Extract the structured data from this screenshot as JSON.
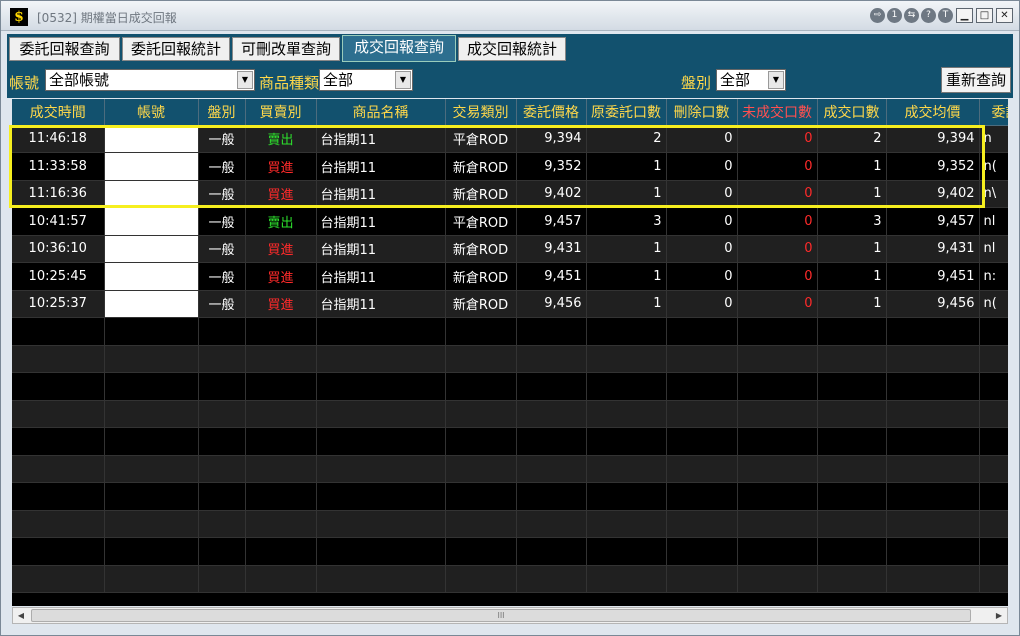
{
  "window": {
    "title": "[0532] 期權當日成交回報",
    "round_buttons": [
      "⇨",
      "1",
      "⇆",
      "?",
      "T"
    ],
    "min": "▁",
    "max": "□",
    "close": "✕"
  },
  "app_icon": "$",
  "tabs": [
    {
      "label": "委託回報查詢"
    },
    {
      "label": "委託回報統計"
    },
    {
      "label": "可刪改單查詢"
    },
    {
      "label": "成交回報查詢"
    },
    {
      "label": "成交回報統計"
    }
  ],
  "filters": {
    "account_label": "帳號",
    "account_value": "全部帳號",
    "product_label": "商品種類",
    "product_value": "全部",
    "session_label": "盤別",
    "session_value": "全部",
    "query_button": "重新查詢"
  },
  "columns": [
    "成交時間",
    "帳號",
    "盤別",
    "買賣別",
    "商品名稱",
    "交易類別",
    "委託價格",
    "原委託口數",
    "刪除口數",
    "未成交口數",
    "成交口數",
    "成交均價",
    "委託"
  ],
  "rows": [
    {
      "time": "11:46:18",
      "account": "",
      "session": "一般",
      "side": "賣出",
      "product": "台指期11",
      "type": "平倉ROD",
      "price": "9,394",
      "orig": "2",
      "del": "0",
      "unfilled": "0",
      "filled": "2",
      "avg": "9,394",
      "extra": "n"
    },
    {
      "time": "11:33:58",
      "account": "",
      "session": "一般",
      "side": "買進",
      "product": "台指期11",
      "type": "新倉ROD",
      "price": "9,352",
      "orig": "1",
      "del": "0",
      "unfilled": "0",
      "filled": "1",
      "avg": "9,352",
      "extra": "n("
    },
    {
      "time": "11:16:36",
      "account": "",
      "session": "一般",
      "side": "買進",
      "product": "台指期11",
      "type": "新倉ROD",
      "price": "9,402",
      "orig": "1",
      "del": "0",
      "unfilled": "0",
      "filled": "1",
      "avg": "9,402",
      "extra": "n\\"
    },
    {
      "time": "10:41:57",
      "account": "",
      "session": "一般",
      "side": "賣出",
      "product": "台指期11",
      "type": "平倉ROD",
      "price": "9,457",
      "orig": "3",
      "del": "0",
      "unfilled": "0",
      "filled": "3",
      "avg": "9,457",
      "extra": "nl"
    },
    {
      "time": "10:36:10",
      "account": "",
      "session": "一般",
      "side": "買進",
      "product": "台指期11",
      "type": "新倉ROD",
      "price": "9,431",
      "orig": "1",
      "del": "0",
      "unfilled": "0",
      "filled": "1",
      "avg": "9,431",
      "extra": "nl"
    },
    {
      "time": "10:25:45",
      "account": "",
      "session": "一般",
      "side": "買進",
      "product": "台指期11",
      "type": "新倉ROD",
      "price": "9,451",
      "orig": "1",
      "del": "0",
      "unfilled": "0",
      "filled": "1",
      "avg": "9,451",
      "extra": "n:"
    },
    {
      "time": "10:25:37",
      "account": "",
      "session": "一般",
      "side": "買進",
      "product": "台指期11",
      "type": "新倉ROD",
      "price": "9,456",
      "orig": "1",
      "del": "0",
      "unfilled": "0",
      "filled": "1",
      "avg": "9,456",
      "extra": "n("
    }
  ],
  "scrollbar": {
    "left": "◀",
    "right": "▶",
    "grip": "III"
  },
  "colors": {
    "header_bg": "#12516e",
    "header_text": "#ffd84a",
    "buy": "#ff2a2a",
    "sell": "#2ddf2d",
    "highlight": "#f6ef1f"
  }
}
